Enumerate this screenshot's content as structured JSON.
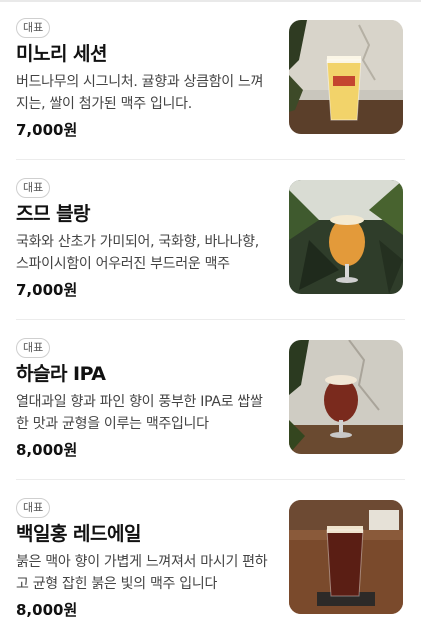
{
  "menu": {
    "items": [
      {
        "badge": "대표",
        "name": "미노리 세션",
        "description": "버드나무의 시그니처. 귤향과 상큼함이 느껴지는, 쌀이 첨가된 맥주 입니다.",
        "price": "7,000원",
        "photo_icon": "beer-glass-pale-icon"
      },
      {
        "badge": "대표",
        "name": "즈므 블랑",
        "description": "국화와 산초가 가미되어, 국화향, 바나나향, 스파이시함이 어우러진 부드러운 맥주",
        "price": "7,000원",
        "photo_icon": "beer-glass-wheat-icon"
      },
      {
        "badge": "대표",
        "name": "하슬라 IPA",
        "description": "열대과일 향과 파인 향이 풍부한 IPA로 쌉쌀한 맛과 균형을 이루는 맥주입니다",
        "price": "8,000원",
        "photo_icon": "beer-glass-ipa-icon"
      },
      {
        "badge": "대표",
        "name": "백일홍 레드에일",
        "description": "붉은 맥아 향이 가볍게 느껴져서 마시기 편하고 균형 잡힌 붉은 빛의 맥주 입니다",
        "price": "8,000원",
        "photo_icon": "beer-pint-red-icon"
      }
    ]
  }
}
